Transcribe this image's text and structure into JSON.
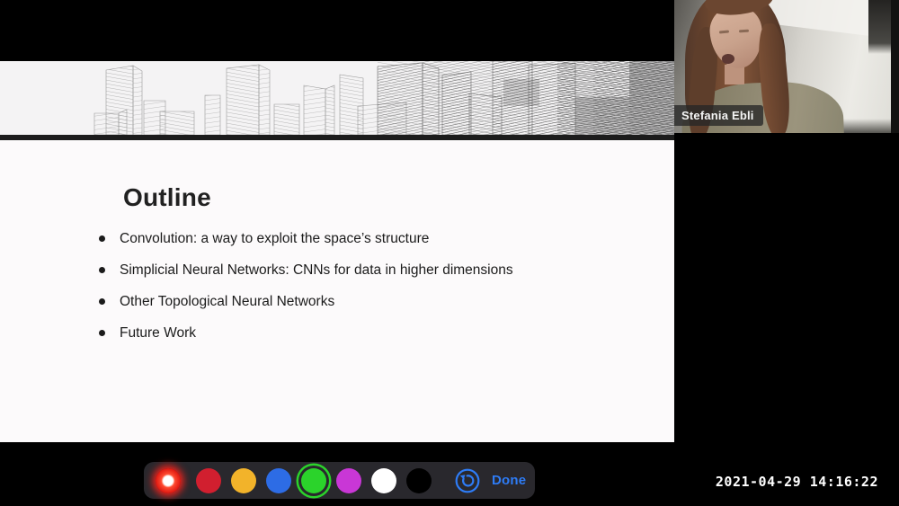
{
  "slide": {
    "title": "Outline",
    "bullets": [
      "Convolution: a way to exploit the space’s structure",
      "Simplicial Neural Networks: CNNs for data in higher dimensions",
      "Other Topological Neural Networks",
      "Future Work"
    ]
  },
  "webcam": {
    "participant_name": "Stefania Ebli"
  },
  "toolbar": {
    "done_label": "Done",
    "accent_color": "#2e7cf6",
    "swatches": [
      {
        "name": "laser-pointer",
        "color": "#ff231c",
        "selected": true
      },
      {
        "name": "red",
        "color": "#d11f2f"
      },
      {
        "name": "yellow",
        "color": "#f2b32a"
      },
      {
        "name": "blue",
        "color": "#2d6ce5"
      },
      {
        "name": "green",
        "color": "#2bd32b",
        "selected": true
      },
      {
        "name": "magenta",
        "color": "#c937d6"
      },
      {
        "name": "white",
        "color": "#ffffff"
      },
      {
        "name": "black",
        "color": "#000000"
      }
    ]
  },
  "timestamp": "2021-04-29 14:16:22"
}
